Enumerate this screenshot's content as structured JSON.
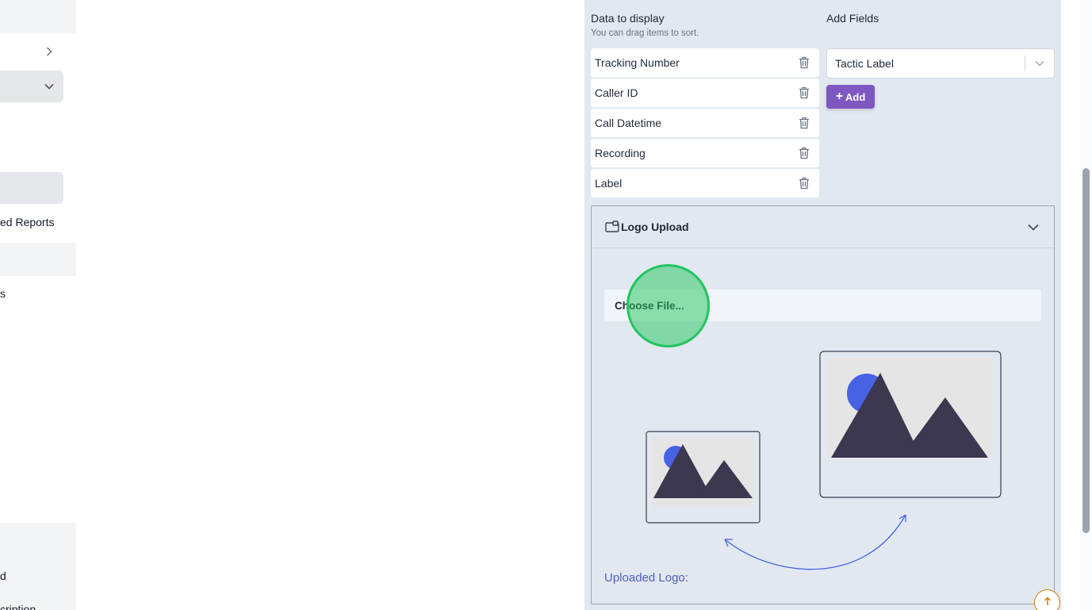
{
  "sidebar": {
    "partial_texts": [
      "ed Reports",
      "s",
      "d",
      "cription"
    ]
  },
  "data_panel": {
    "title": "Data to display",
    "subtitle": "You can drag items to sort.",
    "items": [
      {
        "label": "Tracking Number"
      },
      {
        "label": "Caller ID"
      },
      {
        "label": "Call Datetime"
      },
      {
        "label": "Recording"
      },
      {
        "label": "Label"
      }
    ]
  },
  "add_fields": {
    "title": "Add Fields",
    "select_value": "Tactic Label",
    "add_button_label": "Add",
    "add_button_icon": "+"
  },
  "logo_upload": {
    "title": "Logo Upload",
    "choose_file_label": "Choose File...",
    "uploaded_label": "Uploaded Logo:"
  },
  "colors": {
    "panel_bg": "#e2e8f0",
    "accent_purple": "#7e57c2",
    "uploaded_label": "#4f5fbf",
    "illustration_blue": "#4763e4",
    "illustration_dark": "#3b3850",
    "click_marker": "#22c55e"
  },
  "icons": {
    "trash": "trash-icon",
    "logo_upload": "folder-image-icon",
    "accordion": "chevron-down-icon",
    "select": "chevron-down-icon",
    "scroll_top": "arrow-up-icon"
  }
}
